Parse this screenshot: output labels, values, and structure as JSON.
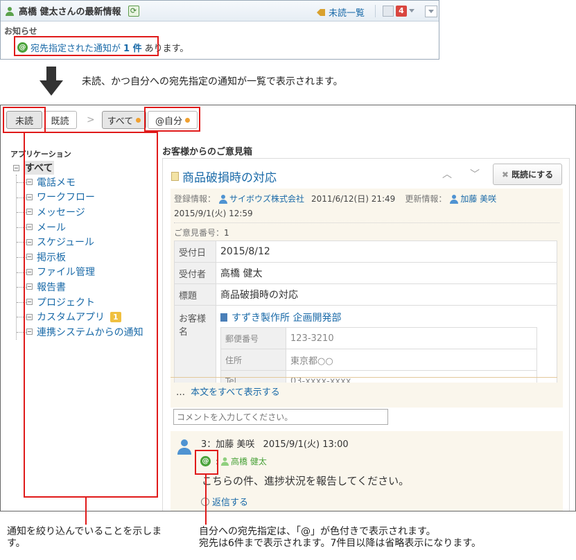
{
  "top_panel": {
    "title": "高橋 健太さんの最新情報",
    "unread_link": "未読一覧",
    "badge_count": "4",
    "notice_label": "お知らせ",
    "notice_link": "宛先指定された通知が",
    "notice_count": "1 件",
    "notice_suffix": "あります。"
  },
  "caption_arrow": "未読、かつ自分への宛先指定の通知が一覧で表示されます。",
  "tabs": {
    "unread": "未読",
    "read": "既読",
    "all": "すべて",
    "mine": "@自分"
  },
  "tree": {
    "heading": "アプリケーション",
    "root": "すべて",
    "items": [
      {
        "label": "電話メモ"
      },
      {
        "label": "ワークフロー"
      },
      {
        "label": "メッセージ"
      },
      {
        "label": "メール"
      },
      {
        "label": "スケジュール"
      },
      {
        "label": "掲示板"
      },
      {
        "label": "ファイル管理"
      },
      {
        "label": "報告書"
      },
      {
        "label": "プロジェクト"
      },
      {
        "label": "カスタムアプリ",
        "badge": "1"
      },
      {
        "label": "連携システムからの通知"
      }
    ]
  },
  "content": {
    "app_title": "お客様からのご意見箱",
    "subject": "商品破損時の対応",
    "read_button": "既読にする",
    "meta": {
      "registered_label": "登録情報：",
      "registered_by": "サイボウズ株式会社",
      "registered_at": "2011/6/12(日) 21:49",
      "updated_label": "更新情報：",
      "updated_by": "加藤 美咲",
      "updated_at": "2015/9/1(火) 12:59",
      "number_label": "ご意見番号：",
      "number": "1"
    },
    "fields": {
      "received_date_label": "受付日",
      "received_date": "2015/8/12",
      "receiver_label": "受付者",
      "receiver": "高橋 健太",
      "subject_label": "標題",
      "subject": "商品破損時の対応",
      "customer_label": "お客様名",
      "customer": "すずき製作所 企画開発部",
      "postal_label": "郵便番号",
      "postal": "123-3210",
      "address_label": "住所",
      "address": "東京都○○",
      "tel_label": "Tel",
      "tel": "03-xxxx-xxxx"
    },
    "show_all": "本文をすべて表示する",
    "comment_placeholder": "コメントを入力してください。",
    "comment": {
      "header": "3：加藤 美咲",
      "time": "2015/9/1(火) 13:00",
      "mention": "高橋 健太",
      "body": "こちらの件、進捗状況を報告してください。",
      "reply": "返信する"
    }
  },
  "caption_filter": "通知を絞り込んでいることを示します。",
  "caption_mention_1": "自分への宛先指定は、「@」が色付きで表示されます。",
  "caption_mention_2": "宛先は6件まで表示されます。7件目以降は省略表示になります。"
}
